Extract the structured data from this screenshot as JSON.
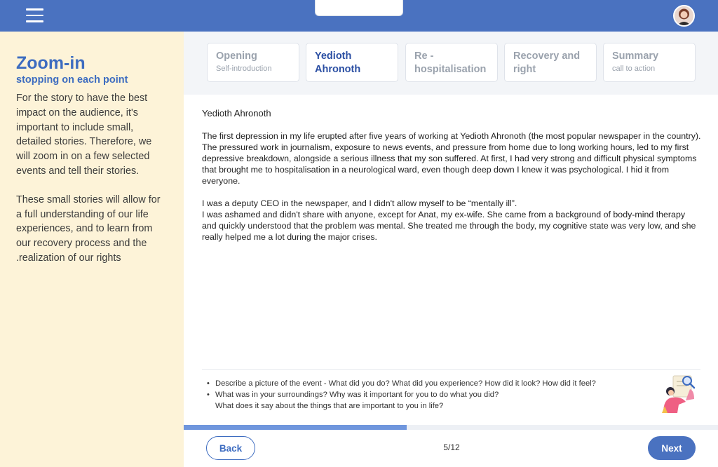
{
  "header": {
    "menu_icon": "hamburger-menu-icon",
    "avatar_icon": "user-avatar",
    "accent_color": "#4a72c0"
  },
  "sidebar": {
    "title": "Zoom-in",
    "subtitle": "stopping on each point",
    "paragraph1": "For the story to have the best impact on the audience, it's important to include small, detailed stories. Therefore, we will zoom in on a few selected events and tell their stories.",
    "paragraph2": "These small stories will allow for a full understanding of our life experiences, and to learn from our recovery process and the .realization of our rights",
    "background_color": "#fdf3d8"
  },
  "tabs": [
    {
      "title": "Opening",
      "sub": "Self-introduction",
      "active": false
    },
    {
      "title": "Yedioth Ahronoth",
      "sub": "",
      "active": true
    },
    {
      "title": "Re - hospitalisation",
      "sub": "",
      "active": false
    },
    {
      "title": "Recovery and right",
      "sub": "",
      "active": false
    },
    {
      "title": "Summary",
      "sub": "call to action",
      "active": false
    }
  ],
  "content": {
    "heading": "Yedioth Ahronoth",
    "paragraph1": "The first depression in my life erupted after five years of working at Yedioth Ahronoth (the most popular newspaper in the country). The pressured work in journalism, exposure to news events, and pressure from home due to long working hours, led to my first depressive breakdown, alongside a serious illness that my son suffered. At first, I had very strong and difficult physical symptoms that brought me to hospitalisation in a neurological ward, even though deep down I knew it was psychological. I hid it from everyone.",
    "paragraph2a": "I was a deputy CEO in the newspaper, and I didn't allow myself to be “mentally ill”.",
    "paragraph2b": "I was ashamed and didn't share with anyone, except for Anat, my ex-wife. She came from a background of body-mind therapy and quickly understood that the problem was mental. She treated me through the body, my cognitive state was very low, and she really helped me a lot during the major crises."
  },
  "questions": [
    {
      "line1": "Describe a picture of the event - What did you do? What did you experience? How did it look? How did it feel?",
      "line2": ""
    },
    {
      "line1": "What was in your surroundings? Why was it important for you to do what you did?",
      "line2": "What does it say about the things that are important to you in life?"
    }
  ],
  "illustration_icon": "person-with-magnifier-illustration",
  "progress": {
    "fraction": 0.417,
    "color": "#6f96dd"
  },
  "footer": {
    "back_label": "Back",
    "next_label": "Next",
    "page_count": "5/12"
  }
}
